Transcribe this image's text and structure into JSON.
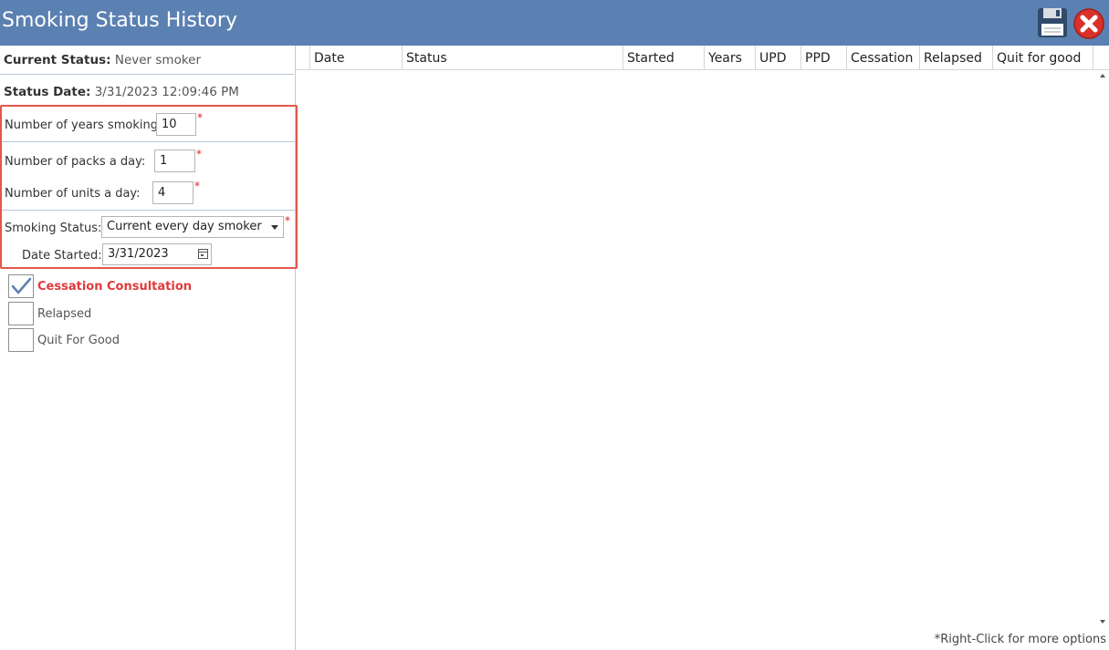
{
  "window": {
    "title": "Smoking Status History",
    "accent_color": "#5b80b2"
  },
  "toolbar": {
    "save_icon": "save-icon",
    "close_icon": "close-icon"
  },
  "summary": {
    "current_status_label": "Current Status:",
    "current_status_value": "Never smoker",
    "status_date_label": "Status Date:",
    "status_date_value": "3/31/2023 12:09:46 PM"
  },
  "form": {
    "years_label": "Number of years smoking:",
    "years_value": "10",
    "packs_label": "Number of packs a day:",
    "packs_value": "1",
    "units_label": "Number of units a day:",
    "units_value": "4",
    "status_label": "Smoking Status:",
    "status_value": "Current every day smoker",
    "date_started_label": "Date Started:",
    "date_started_value": "3/31/2023",
    "required_marker": "*"
  },
  "checkboxes": [
    {
      "label": "Cessation Consultation",
      "checked": true
    },
    {
      "label": "Relapsed",
      "checked": false
    },
    {
      "label": "Quit For Good",
      "checked": false
    }
  ],
  "grid": {
    "columns": [
      "Date",
      "Status",
      "Started",
      "Years",
      "UPD",
      "PPD",
      "Cessation",
      "Relapsed",
      "Quit for good"
    ],
    "rows": []
  },
  "footer": {
    "hint": "*Right-Click for more options"
  }
}
